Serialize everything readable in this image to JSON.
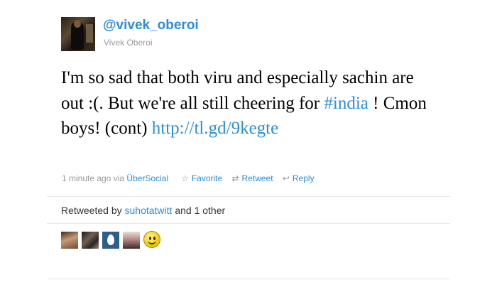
{
  "tweet": {
    "screen_name": "@vivek_oberoi",
    "full_name": "Vivek Oberoi",
    "text_part1": "I'm so sad that both viru and especially sachin are out :(. But we're all still cheering for ",
    "hashtag": "#india",
    "text_part2": " ! Cmon boys! (cont) ",
    "link": "http://tl.gd/9kegte",
    "timestamp": "1 minute ago",
    "via_prefix": "via",
    "via_app": "ÜberSocial",
    "actions": {
      "favorite": "Favorite",
      "retweet": "Retweet",
      "reply": "Reply"
    },
    "retweeted_by": {
      "prefix": "Retweeted by",
      "user": "suhotatwitt",
      "suffix": "and 1 other"
    }
  },
  "icons": {
    "favorite": "star-icon",
    "retweet": "retweet-icon",
    "reply": "reply-icon"
  },
  "colors": {
    "link": "#2c8ed6",
    "meta_text": "#999999",
    "tweet_text": "#000000"
  }
}
